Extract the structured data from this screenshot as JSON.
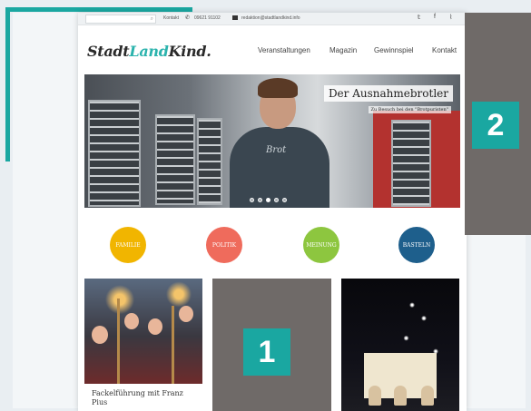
{
  "topbar": {
    "contact_label": "Kontakt",
    "phone": "09621 91102",
    "email": "redaktion@stadtlandkind.info",
    "social_icons": [
      "twitter-icon",
      "facebook-icon",
      "rss-icon"
    ]
  },
  "logo": {
    "part1": "Stadt",
    "part2": "Land",
    "part3": "Kind."
  },
  "nav": {
    "items": [
      "Veranstaltungen",
      "Magazin",
      "Gewinnspiel",
      "Kontakt"
    ]
  },
  "hero": {
    "title": "Der Ausnahmebrotler",
    "subtitle": "Zu Besuch bei den \"Brotpuristen\"",
    "shirt_text": "Brot",
    "slide_count": 5,
    "active_slide": 2
  },
  "categories": [
    {
      "label": "FAMILIE",
      "color": "#f1b500"
    },
    {
      "label": "POLITIK",
      "color": "#ef6b5c"
    },
    {
      "label": "MEINUNG",
      "color": "#8dc63f"
    },
    {
      "label": "BASTELN",
      "color": "#1e5f8c"
    }
  ],
  "cards": [
    {
      "title": "Fackelführung mit Franz Pius"
    }
  ],
  "overlay": {
    "badge_1": "1",
    "badge_2": "2"
  },
  "colors": {
    "accent": "#1aa7a1",
    "overlay_gray": "#6f6a68"
  }
}
